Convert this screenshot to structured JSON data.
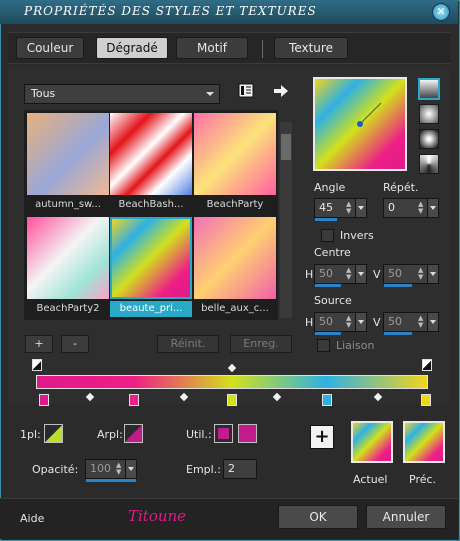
{
  "window": {
    "title": "Propriétés des styles et textures",
    "close_glyph": "✕"
  },
  "tabs": [
    {
      "label": "Couleur"
    },
    {
      "label": "Dégradé"
    },
    {
      "label": "Motif"
    },
    {
      "label": "Texture"
    }
  ],
  "active_tab": "Dégradé",
  "category": {
    "value": "Tous"
  },
  "gradients": [
    {
      "name": "autumn_sw...",
      "colors": [
        "#e9b17d",
        "#9aa7d6",
        "#f0b894"
      ]
    },
    {
      "name": "BeachBash...",
      "colors": [
        "#ffffff",
        "#e3141b",
        "#ffffff"
      ]
    },
    {
      "name": "BeachParty",
      "colors": [
        "#ff6fa7",
        "#fbe37a",
        "#ff5fa2"
      ]
    },
    {
      "name": "BeachParty2",
      "colors": [
        "#ff4f9d",
        "#f4f4f4",
        "#9fe3d5"
      ]
    },
    {
      "name": "beaute_pri...",
      "colors": [
        "#e0198a",
        "#d2e11c",
        "#2fb0e4"
      ]
    },
    {
      "name": "belle_aux_c...",
      "colors": [
        "#f070b8",
        "#ffd070",
        "#f060a8"
      ]
    }
  ],
  "selected_gradient": "beaute_pri...",
  "buttons": {
    "add": "+",
    "remove": "-",
    "reset": "Réinit.",
    "save": "Enreg."
  },
  "angle": {
    "label": "Angle",
    "value": "45"
  },
  "repeat": {
    "label": "Répét.",
    "value": "0"
  },
  "invert": {
    "label": "Invers",
    "checked": false
  },
  "center": {
    "label": "Centre",
    "h_label": "H",
    "h_value": "50",
    "v_label": "V",
    "v_value": "50"
  },
  "source": {
    "label": "Source",
    "h_label": "H",
    "h_value": "50",
    "v_label": "V",
    "v_value": "50"
  },
  "link": {
    "label": "Liaison",
    "checked": false
  },
  "stop_1pl": {
    "label": "1pl:"
  },
  "stop_arpl": {
    "label": "Arpl:"
  },
  "util": {
    "label": "Util.:"
  },
  "opacity": {
    "label": "Opacité:",
    "value": "100"
  },
  "location": {
    "label": "Empl.:",
    "value": "2"
  },
  "current": {
    "label": "Actuel"
  },
  "previous": {
    "label": "Préc."
  },
  "footer": {
    "help": "Aide",
    "signature": "Titoune",
    "ok": "OK",
    "cancel": "Annuler"
  },
  "colors": {
    "accent": "#2aa8c7",
    "stop_magenta": "#e0198a",
    "stop_pink": "#ee1f86",
    "stop_lime": "#d2e11c",
    "stop_blue": "#2fb0e4",
    "stop_yellow": "#f2d51a"
  }
}
